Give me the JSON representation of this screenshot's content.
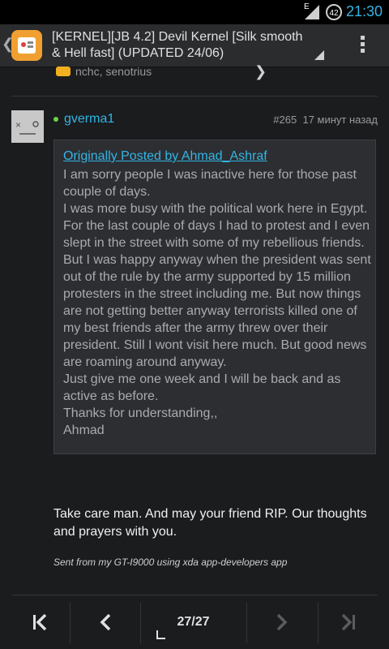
{
  "statusbar": {
    "time": "21:30",
    "battery_level": "42",
    "network": "E",
    "icons": [
      "signal-icon",
      "battery-icon"
    ]
  },
  "actionbar": {
    "title": "[KERNEL][JB 4.2] Devil Kernel [Silk smooth & Hell fast] (UPDATED 24/06)",
    "icons": [
      "app-icon",
      "overflow-menu-icon"
    ]
  },
  "thanks": {
    "names": "nchc, senotrius",
    "icon": "thumbs-up-icon"
  },
  "post": {
    "username": "gverma1",
    "number": "#265",
    "time_ago": "17 минут назад",
    "quote": {
      "header": "Originally Posted by Ahmad_Ashraf",
      "lines": [
        "I am sorry people I was inactive here for those past couple of days.",
        "I was more busy with the political work here in Egypt. For the last couple of days I had to protest and I even slept in the street with some of my rebellious friends. But I was happy anyway when the president was sent out of the rule by the army supported by 15 million protesters in the street including me. But now things are not getting better anyway terrorists killed one of my best friends after the army threw over their president. Still I wont visit here much. But good news are roaming around anyway.",
        "Just give me one week and I will be back and as active as before.",
        "Thanks for understanding,,",
        "Ahmad"
      ]
    },
    "reply": "Take care man. And may your friend RIP. Our thoughts and prayers with you.",
    "signature": "Sent from my GT-I9000 using xda app-developers app"
  },
  "pager": {
    "current": "27",
    "total": "27",
    "separator": "/"
  }
}
